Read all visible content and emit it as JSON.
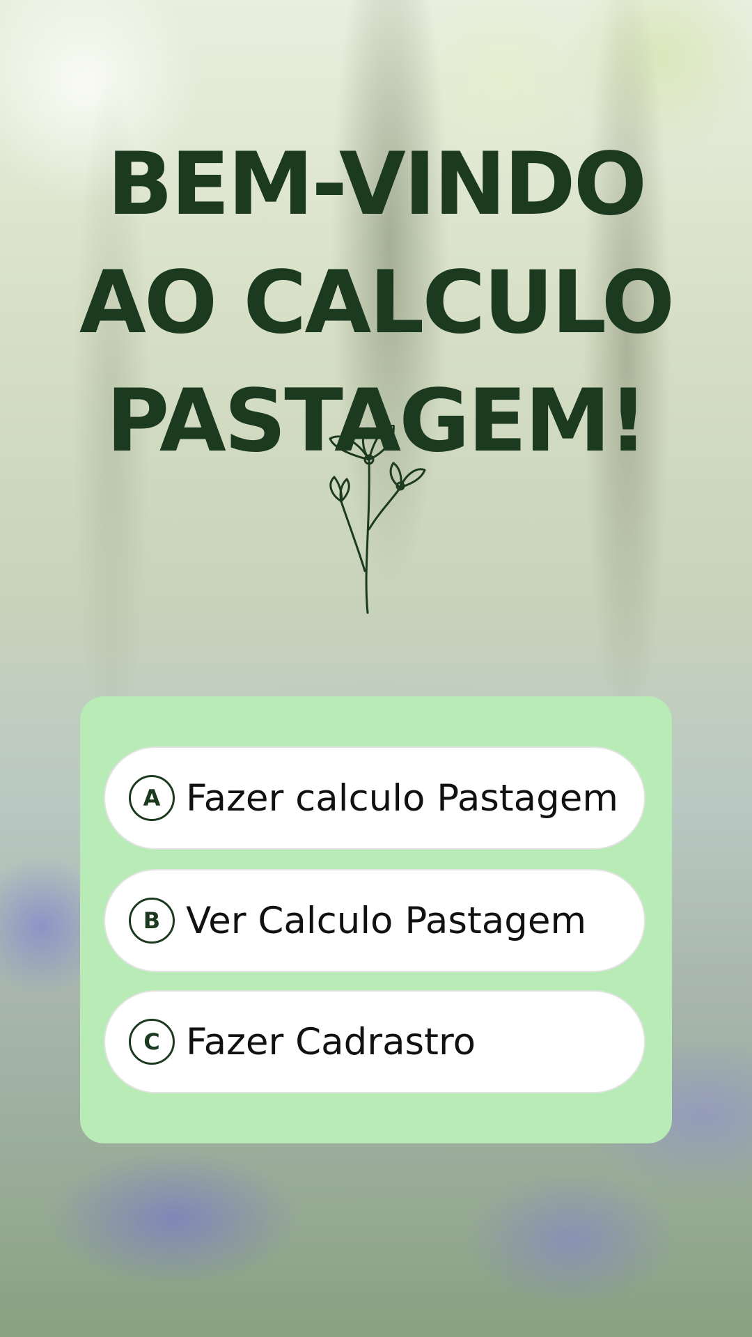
{
  "page": {
    "title": "BEM-VINDO\nAO CALCULO\nPASTAGEM!",
    "decoration_icon": "flower-icon"
  },
  "menu": {
    "options": [
      {
        "letter": "A",
        "label": "Fazer calculo Pastagem"
      },
      {
        "letter": "B",
        "label": "Ver Calculo Pastagem"
      },
      {
        "letter": "C",
        "label": "Fazer Cadrastro"
      }
    ]
  },
  "colors": {
    "title": "#1c3a1f",
    "card": "#b8ebb5",
    "option_bg": "#ffffff",
    "option_text": "#111111"
  }
}
